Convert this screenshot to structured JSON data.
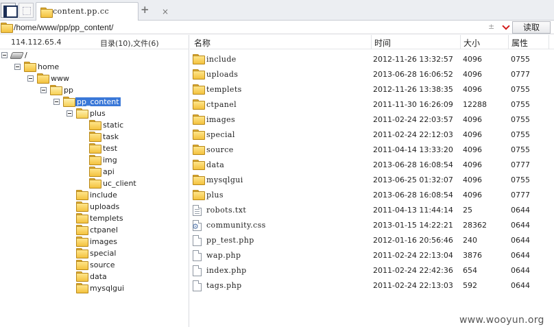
{
  "tabs": [
    {
      "label": "content.pp.cc"
    }
  ],
  "tab_bar": {
    "close_glyph": "×",
    "new_glyph": "+"
  },
  "address": {
    "path": "/home/www/pp/pp_content/",
    "arrows": "± ",
    "read_label": "读取"
  },
  "left_panel": {
    "ip": "114.112.65.4",
    "counts": "目录(10),文件(6)",
    "tree": [
      {
        "label": "/",
        "icon": "drive-icon",
        "expanded": true
      },
      {
        "label": "home",
        "icon": "folder-icon",
        "expanded": true
      },
      {
        "label": "www",
        "icon": "folder-icon",
        "expanded": true
      },
      {
        "label": "pp",
        "icon": "folder-open-icon",
        "expanded": true
      },
      {
        "label": "pp_content",
        "icon": "folder-open-icon",
        "expanded": true,
        "selected": true
      },
      {
        "label": "plus",
        "icon": "folder-open-icon",
        "expanded": true
      },
      {
        "label": "static",
        "icon": "folder-icon"
      },
      {
        "label": "task",
        "icon": "folder-icon"
      },
      {
        "label": "test",
        "icon": "folder-icon"
      },
      {
        "label": "img",
        "icon": "folder-icon"
      },
      {
        "label": "api",
        "icon": "folder-icon"
      },
      {
        "label": "uc_client",
        "icon": "folder-icon"
      },
      {
        "label": "include",
        "icon": "folder-icon"
      },
      {
        "label": "uploads",
        "icon": "folder-icon"
      },
      {
        "label": "templets",
        "icon": "folder-icon"
      },
      {
        "label": "ctpanel",
        "icon": "folder-icon"
      },
      {
        "label": "images",
        "icon": "folder-icon"
      },
      {
        "label": "special",
        "icon": "folder-icon"
      },
      {
        "label": "source",
        "icon": "folder-icon"
      },
      {
        "label": "data",
        "icon": "folder-icon"
      },
      {
        "label": "mysqlgui",
        "icon": "folder-icon"
      }
    ]
  },
  "file_list": {
    "columns": [
      "名称",
      "时间",
      "大小",
      "属性"
    ],
    "rows": [
      {
        "name": "include",
        "type": "folder",
        "time": "2012-11-26 13:32:57",
        "size": "4096",
        "attr": "0755"
      },
      {
        "name": "uploads",
        "type": "folder",
        "time": "2013-06-28 16:06:52",
        "size": "4096",
        "attr": "0777"
      },
      {
        "name": "templets",
        "type": "folder",
        "time": "2012-11-26 13:38:35",
        "size": "4096",
        "attr": "0755"
      },
      {
        "name": "ctpanel",
        "type": "folder",
        "time": "2011-11-30 16:26:09",
        "size": "12288",
        "attr": "0755"
      },
      {
        "name": "images",
        "type": "folder",
        "time": "2011-02-24 22:03:57",
        "size": "4096",
        "attr": "0755"
      },
      {
        "name": "special",
        "type": "folder",
        "time": "2011-02-24 22:12:03",
        "size": "4096",
        "attr": "0755"
      },
      {
        "name": "source",
        "type": "folder",
        "time": "2011-04-14 13:33:20",
        "size": "4096",
        "attr": "0755"
      },
      {
        "name": "data",
        "type": "folder",
        "time": "2013-06-28 16:08:54",
        "size": "4096",
        "attr": "0777"
      },
      {
        "name": "mysqlgui",
        "type": "folder",
        "time": "2013-06-25 01:32:07",
        "size": "4096",
        "attr": "0755"
      },
      {
        "name": "plus",
        "type": "folder",
        "time": "2013-06-28 16:08:54",
        "size": "4096",
        "attr": "0777"
      },
      {
        "name": "robots.txt",
        "type": "txt",
        "time": "2011-04-13 11:44:14",
        "size": "25",
        "attr": "0644"
      },
      {
        "name": "community.css",
        "type": "css",
        "time": "2013-01-15 14:22:21",
        "size": "28362",
        "attr": "0644"
      },
      {
        "name": "pp_test.php",
        "type": "file",
        "time": "2012-01-16 20:56:46",
        "size": "240",
        "attr": "0644"
      },
      {
        "name": "wap.php",
        "type": "file",
        "time": "2011-02-24 22:13:04",
        "size": "3876",
        "attr": "0644"
      },
      {
        "name": "index.php",
        "type": "file",
        "time": "2011-02-24 22:42:36",
        "size": "654",
        "attr": "0644"
      },
      {
        "name": "tags.php",
        "type": "file",
        "time": "2011-02-24 22:13:03",
        "size": "592",
        "attr": "0644"
      }
    ]
  },
  "watermark": "www.wooyun.org",
  "colors": {
    "selection": "#3a78d8",
    "folder": "#f3c23f",
    "dropdown_arrow": "#d21b1b"
  }
}
